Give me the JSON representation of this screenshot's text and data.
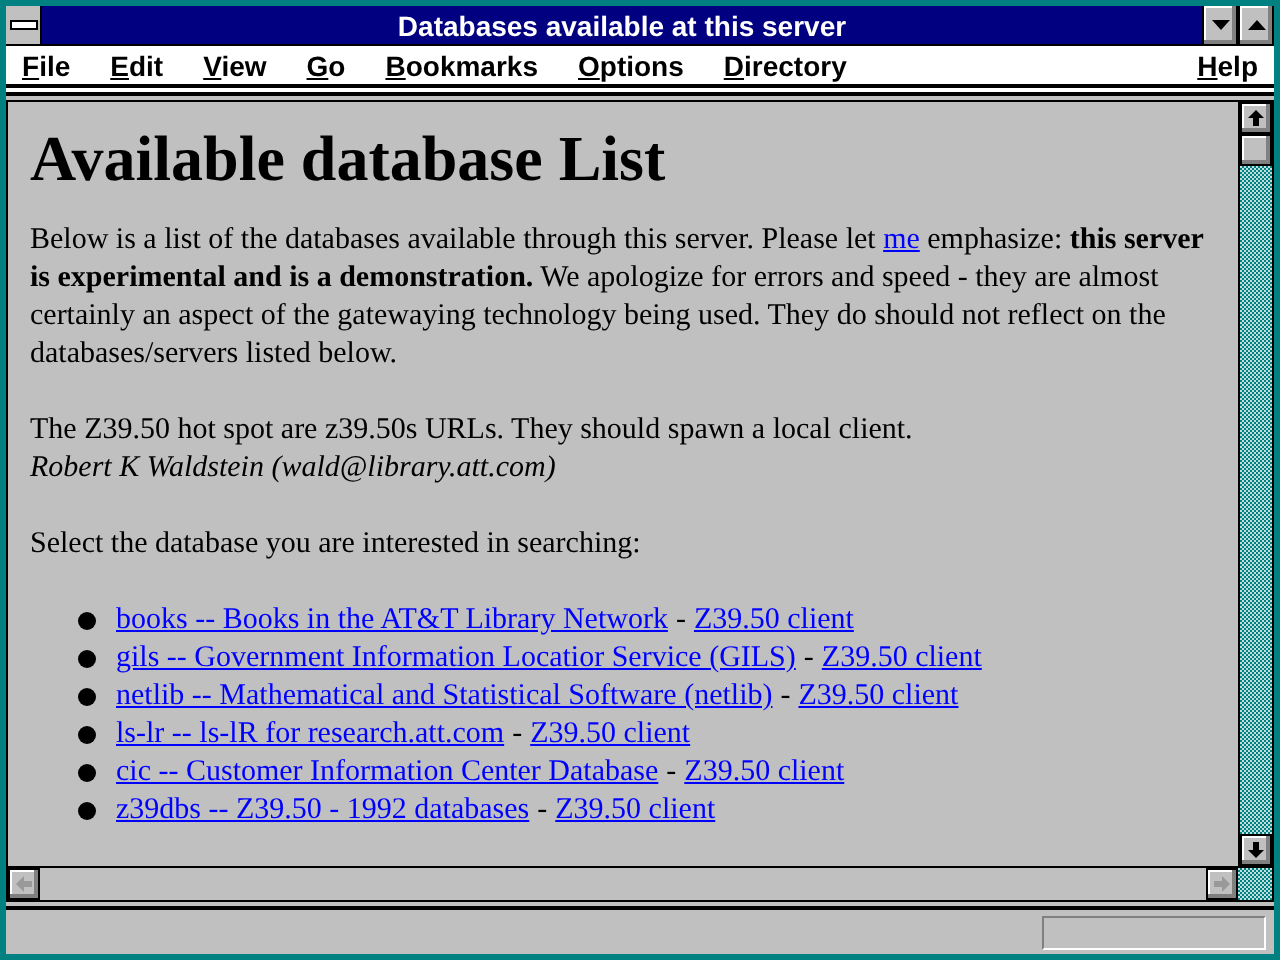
{
  "window": {
    "title": "Databases available at this server"
  },
  "menu": [
    "File",
    "Edit",
    "View",
    "Go",
    "Bookmarks",
    "Options",
    "Directory"
  ],
  "help_menu": "Help",
  "page": {
    "heading": "Available database List",
    "intro": {
      "before": "Below is a list of the databases available through this server. Please let ",
      "link": "me",
      "after": " emphasize: **this server is experimental and is a demonstration.** We apologize for errors and speed - they are almost certainly an aspect of the gatewaying technology being used. They do should not reflect on the databases/servers listed below."
    },
    "note": "The Z39.50 hot spot are z39.50s URLs. They should spawn a local client.",
    "author": "Robert K Waldstein (wald@library.att.com)",
    "prompt": "Select the database you are interested in searching:",
    "databases": [
      {
        "name": "books -- Books in the AT&T Library Network",
        "separator": "-",
        "client": "Z39.50 client"
      },
      {
        "name": "gils -- Government Information Locatior Service (GILS)",
        "separator": "-",
        "client": "Z39.50 client"
      },
      {
        "name": "netlib -- Mathematical and Statistical Software (netlib)",
        "separator": "-",
        "client": "Z39.50 client"
      },
      {
        "name": "ls-lr -- ls-lR for research.att.com",
        "separator": "-",
        "client": "Z39.50 client"
      },
      {
        "name": "cic -- Customer Information Center Database",
        "separator": "-",
        "client": "Z39.50 client"
      },
      {
        "name": "z39dbs -- Z39.50 - 1992 databases",
        "separator": "-",
        "client": "Z39.50 client"
      }
    ]
  }
}
